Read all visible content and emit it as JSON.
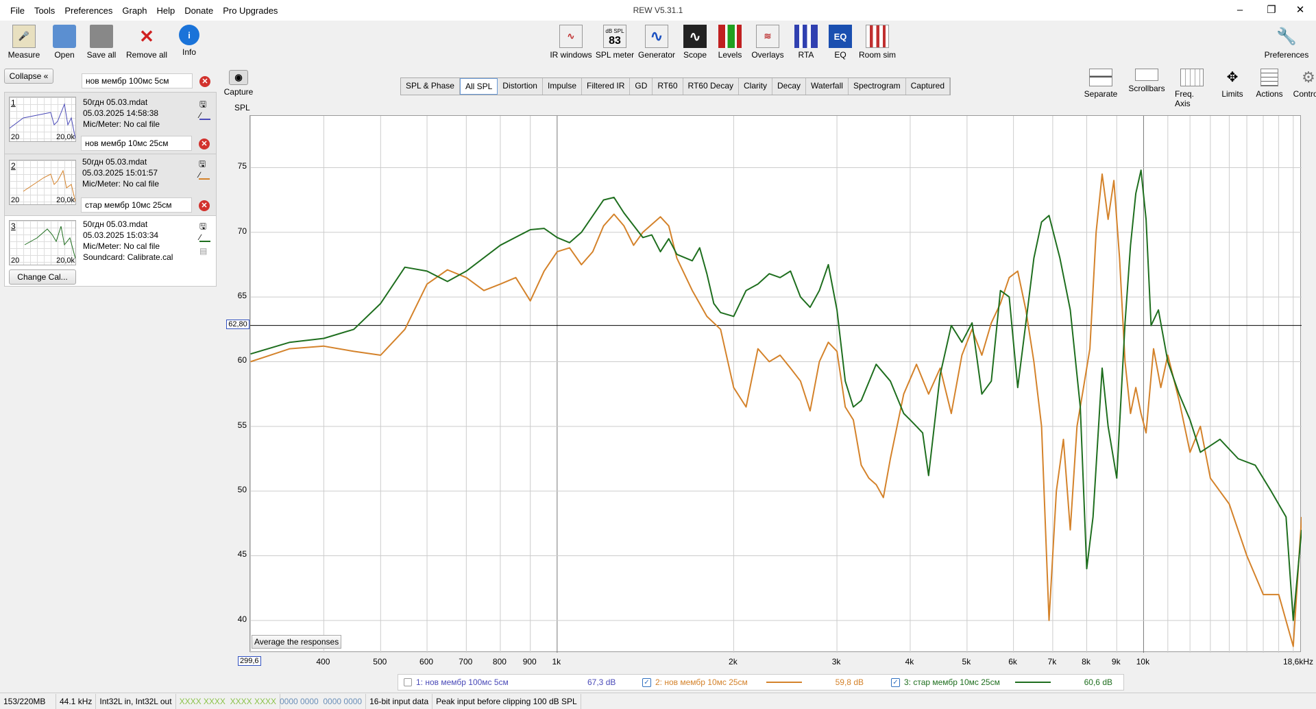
{
  "app": {
    "title": "REW V5.31.1"
  },
  "menu": [
    "File",
    "Tools",
    "Preferences",
    "Graph",
    "Help",
    "Donate",
    "Pro Upgrades"
  ],
  "toolbar_left": [
    {
      "label": "Measure",
      "icon": "measure-icon"
    },
    {
      "label": "Open",
      "icon": "folder-icon"
    },
    {
      "label": "Save all",
      "icon": "save-icon"
    },
    {
      "label": "Remove all",
      "icon": "remove-icon"
    },
    {
      "label": "Info",
      "icon": "info-icon"
    }
  ],
  "toolbar_mid": [
    {
      "label": "IR windows",
      "icon": "ir-windows-icon"
    },
    {
      "label": "SPL meter",
      "icon": "spl-meter-icon",
      "badge": "83",
      "badge_top": "dB SPL"
    },
    {
      "label": "Generator",
      "icon": "generator-icon"
    },
    {
      "label": "Scope",
      "icon": "scope-icon"
    },
    {
      "label": "Levels",
      "icon": "levels-icon"
    },
    {
      "label": "Overlays",
      "icon": "overlays-icon"
    },
    {
      "label": "RTA",
      "icon": "rta-icon"
    },
    {
      "label": "EQ",
      "icon": "eq-icon"
    },
    {
      "label": "Room sim",
      "icon": "room-sim-icon"
    }
  ],
  "preferences_label": "Preferences",
  "capture_label": "Capture",
  "tabs": [
    "SPL & Phase",
    "All SPL",
    "Distortion",
    "Impulse",
    "Filtered IR",
    "GD",
    "RT60",
    "RT60 Decay",
    "Clarity",
    "Decay",
    "Waterfall",
    "Spectrogram",
    "Captured"
  ],
  "active_tab": "All SPL",
  "right_tools": [
    "Separate",
    "Scrollbars",
    "Freq. Axis",
    "Limits",
    "Actions",
    "Controls"
  ],
  "left_panel": {
    "collapse": "Collapse",
    "change_cal": "Change Cal...",
    "measurements": [
      {
        "num": "1",
        "name": "нов мембр 100мс 5см",
        "file": "50гдн 05.03.mdat",
        "date": "05.03.2025 14:58:38",
        "mic": "Mic/Meter: No cal file",
        "color": "#4a4ab8"
      },
      {
        "num": "2",
        "name": "нов мембр 10мс 25см",
        "file": "50гдн 05.03.mdat",
        "date": "05.03.2025 15:01:57",
        "mic": "Mic/Meter: No cal file",
        "color": "#d4822a"
      },
      {
        "num": "3",
        "name": "стар мембр 10мс 25см",
        "file": "50гдн 05.03.mdat",
        "date": "05.03.2025 15:03:34",
        "mic": "Mic/Meter: No cal file",
        "soundcard": "Soundcard: Calibrate.cal",
        "color": "#1e6e1e"
      }
    ],
    "thumb_min": "20",
    "thumb_max": "20,0k"
  },
  "chart_data": {
    "type": "line",
    "ylabel": "SPL",
    "xscale": "log",
    "xlim": [
      299.6,
      18600
    ],
    "ylim": [
      37.5,
      79
    ],
    "yticks": [
      40,
      45,
      50,
      55,
      60,
      65,
      70,
      75
    ],
    "xticks": [
      {
        "v": 400,
        "l": "400"
      },
      {
        "v": 500,
        "l": "500"
      },
      {
        "v": 600,
        "l": "600"
      },
      {
        "v": 700,
        "l": "700"
      },
      {
        "v": 800,
        "l": "800"
      },
      {
        "v": 900,
        "l": "900"
      },
      {
        "v": 1000,
        "l": "1k"
      },
      {
        "v": 2000,
        "l": "2k"
      },
      {
        "v": 3000,
        "l": "3k"
      },
      {
        "v": 4000,
        "l": "4k"
      },
      {
        "v": 5000,
        "l": "5k"
      },
      {
        "v": 6000,
        "l": "6k"
      },
      {
        "v": 7000,
        "l": "7k"
      },
      {
        "v": 8000,
        "l": "8k"
      },
      {
        "v": 9000,
        "l": "9k"
      },
      {
        "v": 10000,
        "l": "10k"
      }
    ],
    "x_start_label": "299,6",
    "x_end_label": "18,6kHz",
    "cursor_y": 62.8,
    "cursor_y_label": "62,80",
    "average_button": "Average the responses",
    "series": [
      {
        "name": "2: нов мембр 10мс 25см",
        "color": "#d4822a",
        "points": [
          [
            300,
            60
          ],
          [
            350,
            61
          ],
          [
            400,
            61.2
          ],
          [
            450,
            60.8
          ],
          [
            500,
            60.5
          ],
          [
            550,
            62.5
          ],
          [
            600,
            66
          ],
          [
            650,
            67.1
          ],
          [
            700,
            66.5
          ],
          [
            750,
            65.5
          ],
          [
            800,
            66
          ],
          [
            850,
            66.5
          ],
          [
            900,
            64.7
          ],
          [
            950,
            67
          ],
          [
            1000,
            68.5
          ],
          [
            1050,
            68.8
          ],
          [
            1100,
            67.5
          ],
          [
            1150,
            68.5
          ],
          [
            1200,
            70.5
          ],
          [
            1250,
            71.4
          ],
          [
            1300,
            70.5
          ],
          [
            1350,
            69
          ],
          [
            1400,
            70
          ],
          [
            1500,
            71.2
          ],
          [
            1550,
            70.5
          ],
          [
            1600,
            68
          ],
          [
            1700,
            65.5
          ],
          [
            1800,
            63.5
          ],
          [
            1900,
            62.5
          ],
          [
            2000,
            58
          ],
          [
            2100,
            56.5
          ],
          [
            2200,
            61
          ],
          [
            2300,
            60
          ],
          [
            2400,
            60.5
          ],
          [
            2500,
            59.5
          ],
          [
            2600,
            58.5
          ],
          [
            2700,
            56.2
          ],
          [
            2800,
            60
          ],
          [
            2900,
            61.5
          ],
          [
            3000,
            60.8
          ],
          [
            3100,
            56.5
          ],
          [
            3200,
            55.5
          ],
          [
            3300,
            52
          ],
          [
            3400,
            51
          ],
          [
            3500,
            50.5
          ],
          [
            3600,
            49.5
          ],
          [
            3700,
            52.5
          ],
          [
            3900,
            57.5
          ],
          [
            4100,
            59.8
          ],
          [
            4300,
            57.5
          ],
          [
            4500,
            59.5
          ],
          [
            4700,
            56
          ],
          [
            4900,
            60.5
          ],
          [
            5100,
            62.5
          ],
          [
            5300,
            60.5
          ],
          [
            5500,
            63
          ],
          [
            5700,
            64.5
          ],
          [
            5900,
            66.5
          ],
          [
            6100,
            67
          ],
          [
            6300,
            64
          ],
          [
            6500,
            60
          ],
          [
            6700,
            55
          ],
          [
            6900,
            40
          ],
          [
            7100,
            50
          ],
          [
            7300,
            54
          ],
          [
            7500,
            47
          ],
          [
            7700,
            55
          ],
          [
            7900,
            58
          ],
          [
            8100,
            61
          ],
          [
            8300,
            70
          ],
          [
            8500,
            74.5
          ],
          [
            8700,
            71
          ],
          [
            8900,
            74
          ],
          [
            9100,
            68
          ],
          [
            9300,
            60
          ],
          [
            9500,
            56
          ],
          [
            9700,
            58
          ],
          [
            9900,
            56
          ],
          [
            10100,
            54.5
          ],
          [
            10400,
            61
          ],
          [
            10700,
            58
          ],
          [
            11000,
            60.5
          ],
          [
            11500,
            57
          ],
          [
            12000,
            53
          ],
          [
            12500,
            55
          ],
          [
            13000,
            51
          ],
          [
            14000,
            49
          ],
          [
            15000,
            45
          ],
          [
            16000,
            42
          ],
          [
            17000,
            42
          ],
          [
            18000,
            38
          ],
          [
            18600,
            48
          ]
        ]
      },
      {
        "name": "3: стар мембр 10мс 25см",
        "color": "#1e6e1e",
        "points": [
          [
            300,
            60.6
          ],
          [
            350,
            61.5
          ],
          [
            400,
            61.8
          ],
          [
            450,
            62.5
          ],
          [
            500,
            64.5
          ],
          [
            550,
            67.3
          ],
          [
            600,
            67
          ],
          [
            650,
            66.2
          ],
          [
            700,
            67
          ],
          [
            800,
            69
          ],
          [
            900,
            70.2
          ],
          [
            950,
            70.3
          ],
          [
            1000,
            69.6
          ],
          [
            1050,
            69.2
          ],
          [
            1100,
            70
          ],
          [
            1200,
            72.5
          ],
          [
            1250,
            72.7
          ],
          [
            1300,
            71.5
          ],
          [
            1400,
            69.6
          ],
          [
            1450,
            69.8
          ],
          [
            1500,
            68.5
          ],
          [
            1550,
            69.5
          ],
          [
            1600,
            68.3
          ],
          [
            1700,
            67.8
          ],
          [
            1750,
            68.8
          ],
          [
            1800,
            66.8
          ],
          [
            1850,
            64.5
          ],
          [
            1900,
            63.8
          ],
          [
            2000,
            63.5
          ],
          [
            2100,
            65.5
          ],
          [
            2200,
            66
          ],
          [
            2300,
            66.8
          ],
          [
            2400,
            66.5
          ],
          [
            2500,
            67
          ],
          [
            2600,
            65
          ],
          [
            2700,
            64.2
          ],
          [
            2800,
            65.5
          ],
          [
            2900,
            67.5
          ],
          [
            3000,
            64
          ],
          [
            3100,
            58.5
          ],
          [
            3200,
            56.5
          ],
          [
            3300,
            57
          ],
          [
            3500,
            59.8
          ],
          [
            3700,
            58.5
          ],
          [
            3900,
            56
          ],
          [
            4000,
            55.5
          ],
          [
            4100,
            55
          ],
          [
            4200,
            54.5
          ],
          [
            4300,
            51.2
          ],
          [
            4500,
            59
          ],
          [
            4700,
            62.8
          ],
          [
            4900,
            61.5
          ],
          [
            5100,
            63
          ],
          [
            5300,
            57.5
          ],
          [
            5500,
            58.5
          ],
          [
            5700,
            65.5
          ],
          [
            5900,
            65
          ],
          [
            6100,
            58
          ],
          [
            6300,
            63
          ],
          [
            6500,
            68
          ],
          [
            6700,
            70.8
          ],
          [
            6900,
            71.3
          ],
          [
            7200,
            68
          ],
          [
            7500,
            64
          ],
          [
            7800,
            56.5
          ],
          [
            8000,
            44
          ],
          [
            8200,
            48
          ],
          [
            8500,
            59.5
          ],
          [
            8700,
            55
          ],
          [
            9000,
            51
          ],
          [
            9300,
            63
          ],
          [
            9500,
            69
          ],
          [
            9700,
            73
          ],
          [
            9900,
            74.8
          ],
          [
            10100,
            71
          ],
          [
            10300,
            62.8
          ],
          [
            10600,
            64
          ],
          [
            11000,
            60
          ],
          [
            11500,
            57.5
          ],
          [
            12000,
            55.5
          ],
          [
            12500,
            53
          ],
          [
            13500,
            54
          ],
          [
            14500,
            52.5
          ],
          [
            15500,
            52
          ],
          [
            16500,
            50
          ],
          [
            17500,
            48
          ],
          [
            18000,
            40
          ],
          [
            18600,
            47
          ]
        ]
      }
    ]
  },
  "legend": [
    {
      "label": "1: нов мембр 100мс 5см",
      "value": "67,3 dB",
      "checked": false,
      "color": "#4a4ab8"
    },
    {
      "label": "2: нов мембр 10мс 25см",
      "value": "59,8 dB",
      "checked": true,
      "color": "#d4822a"
    },
    {
      "label": "3: стар мембр 10мс 25см",
      "value": "60,6 dB",
      "checked": true,
      "color": "#1e6e1e"
    }
  ],
  "status": {
    "memory": "153/220MB",
    "rate": "44.1 kHz",
    "format": "Int32L in, Int32L out",
    "in_levels": "XXXX XXXX  XXXX XXXX",
    "out_levels": "0000 0000  0000 0000",
    "bits": "16-bit input data",
    "peak": "Peak input before clipping 100 dB SPL"
  }
}
